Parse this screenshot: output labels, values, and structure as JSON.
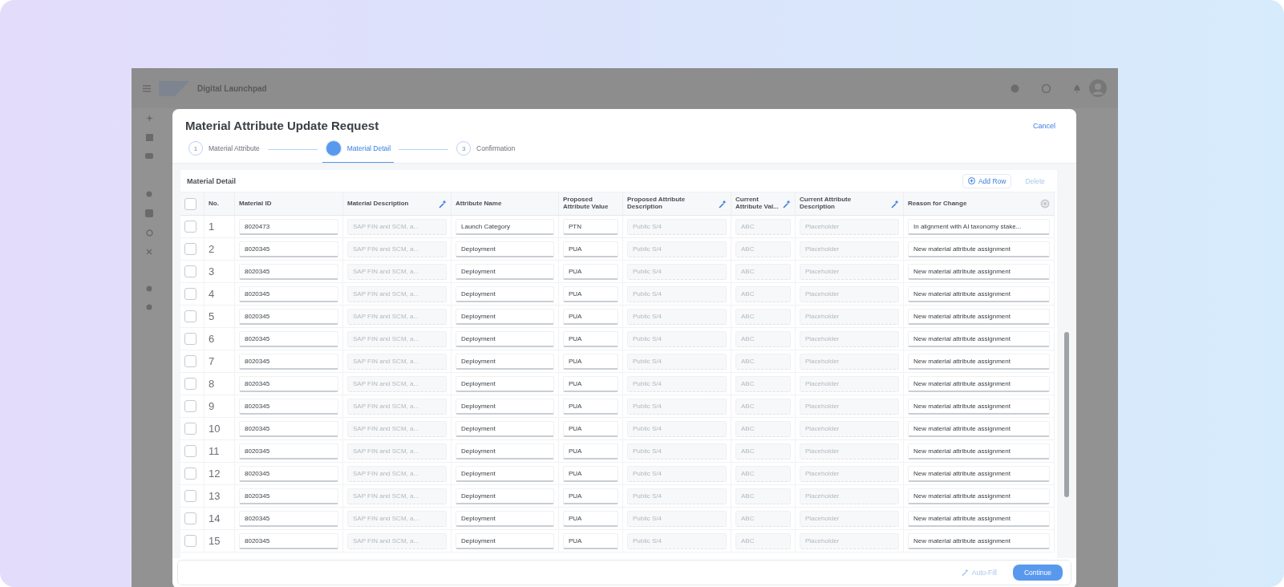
{
  "shell": {
    "title": "Digital Launchpad"
  },
  "dialog": {
    "title": "Material Attribute Update Request",
    "cancel": "Cancel",
    "steps": [
      {
        "number": "1",
        "label": "Material Attribute",
        "selected": false
      },
      {
        "label": "Material Detail",
        "selected": true
      },
      {
        "number": "3",
        "label": "Confirmation",
        "selected": false
      }
    ],
    "panel": {
      "title": "Material Detail",
      "actions": [
        {
          "kind": "add",
          "label": "Add Row",
          "disabled": false
        },
        {
          "kind": "delete",
          "label": "Delete",
          "disabled": true
        }
      ]
    },
    "table": {
      "columns": [
        {
          "label": "No.",
          "kind": "number"
        },
        {
          "label": "Material ID",
          "kind": "field",
          "disabled": false
        },
        {
          "label": "Material Description",
          "kind": "ai-field",
          "disabled": true
        },
        {
          "label": "Attribute Name",
          "kind": "field",
          "disabled": false
        },
        {
          "label": "Proposed Attribute Value",
          "kind": "field",
          "disabled": false
        },
        {
          "label": "Proposed Attribute Description",
          "kind": "ai-field",
          "disabled": true
        },
        {
          "label": "Current Attribute Val...",
          "kind": "ai-field",
          "disabled": true
        },
        {
          "label": "Current Attribute Description",
          "kind": "ai-field",
          "disabled": true
        },
        {
          "label": "Reason for Change",
          "kind": "help-field",
          "disabled": false
        }
      ],
      "select_all": {
        "checked": false
      },
      "rows": [
        {
          "checked": false,
          "cells": [
            "1",
            "8020473",
            "SAP FIN and SCM, a...",
            "Launch Category",
            "PTN",
            "Public S/4",
            "ABC",
            "Placeholder",
            "In alignment with AI taxonomy stake..."
          ]
        },
        {
          "checked": false,
          "cells": [
            "2",
            "8020345",
            "SAP FIN and SCM, a...",
            "Deployment",
            "PUA",
            "Public S/4",
            "ABC",
            "Placeholder",
            "New material attribute assignment"
          ]
        },
        {
          "checked": false,
          "cells": [
            "3",
            "8020345",
            "SAP FIN and SCM, a...",
            "Deployment",
            "PUA",
            "Public S/4",
            "ABC",
            "Placeholder",
            "New material attribute assignment"
          ]
        },
        {
          "checked": false,
          "cells": [
            "4",
            "8020345",
            "SAP FIN and SCM, a...",
            "Deployment",
            "PUA",
            "Public S/4",
            "ABC",
            "Placeholder",
            "New material attribute assignment"
          ]
        },
        {
          "checked": false,
          "cells": [
            "5",
            "8020345",
            "SAP FIN and SCM, a...",
            "Deployment",
            "PUA",
            "Public S/4",
            "ABC",
            "Placeholder",
            "New material attribute assignment"
          ]
        },
        {
          "checked": false,
          "cells": [
            "6",
            "8020345",
            "SAP FIN and SCM, a...",
            "Deployment",
            "PUA",
            "Public S/4",
            "ABC",
            "Placeholder",
            "New material attribute assignment"
          ]
        },
        {
          "checked": false,
          "cells": [
            "7",
            "8020345",
            "SAP FIN and SCM, a...",
            "Deployment",
            "PUA",
            "Public S/4",
            "ABC",
            "Placeholder",
            "New material attribute assignment"
          ]
        },
        {
          "checked": false,
          "cells": [
            "8",
            "8020345",
            "SAP FIN and SCM, a...",
            "Deployment",
            "PUA",
            "Public S/4",
            "ABC",
            "Placeholder",
            "New material attribute assignment"
          ]
        },
        {
          "checked": false,
          "cells": [
            "9",
            "8020345",
            "SAP FIN and SCM, a...",
            "Deployment",
            "PUA",
            "Public S/4",
            "ABC",
            "Placeholder",
            "New material attribute assignment"
          ]
        },
        {
          "checked": false,
          "cells": [
            "10",
            "8020345",
            "SAP FIN and SCM, a...",
            "Deployment",
            "PUA",
            "Public S/4",
            "ABC",
            "Placeholder",
            "New material attribute assignment"
          ]
        },
        {
          "checked": false,
          "cells": [
            "11",
            "8020345",
            "SAP FIN and SCM, a...",
            "Deployment",
            "PUA",
            "Public S/4",
            "ABC",
            "Placeholder",
            "New material attribute assignment"
          ]
        },
        {
          "checked": false,
          "cells": [
            "12",
            "8020345",
            "SAP FIN and SCM, a...",
            "Deployment",
            "PUA",
            "Public S/4",
            "ABC",
            "Placeholder",
            "New material attribute assignment"
          ]
        },
        {
          "checked": false,
          "cells": [
            "13",
            "8020345",
            "SAP FIN and SCM, a...",
            "Deployment",
            "PUA",
            "Public S/4",
            "ABC",
            "Placeholder",
            "New material attribute assignment"
          ]
        },
        {
          "checked": false,
          "cells": [
            "14",
            "8020345",
            "SAP FIN and SCM, a...",
            "Deployment",
            "PUA",
            "Public S/4",
            "ABC",
            "Placeholder",
            "New material attribute assignment"
          ]
        },
        {
          "checked": false,
          "cells": [
            "15",
            "8020345",
            "SAP FIN and SCM, a...",
            "Deployment",
            "PUA",
            "Public S/4",
            "ABC",
            "Placeholder",
            "New material attribute assignment"
          ]
        }
      ]
    },
    "footer": [
      {
        "kind": "ghost",
        "label": "Auto-Fill",
        "disabled": true
      },
      {
        "kind": "primary",
        "label": "Continue",
        "disabled": false
      }
    ]
  }
}
